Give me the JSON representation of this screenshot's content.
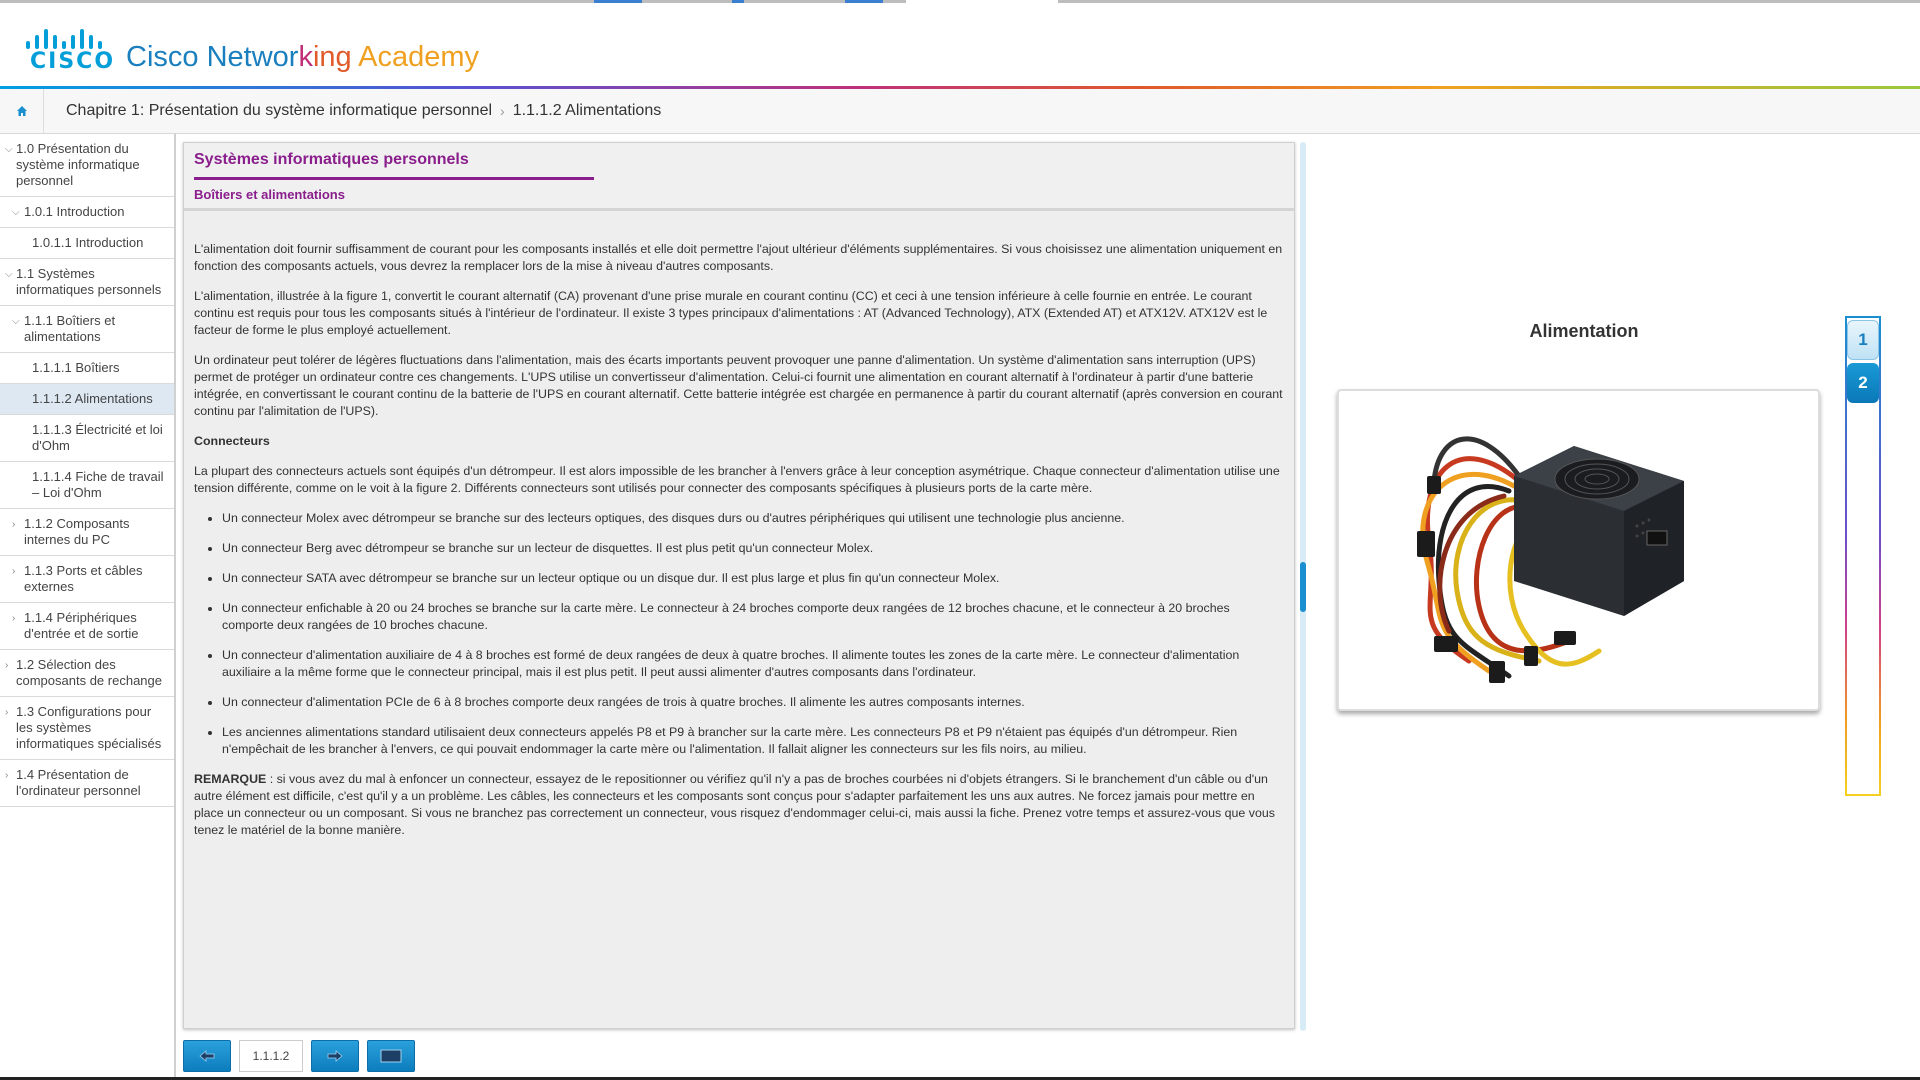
{
  "header": {
    "logo_word": "CISCO",
    "brand_parts": [
      {
        "text": "Cisco Networ",
        "color": "#1a7fbf"
      },
      {
        "text": "k",
        "color": "#c0307a"
      },
      {
        "text": "ing",
        "color": "#e05a2a"
      },
      {
        "text": " Academy",
        "color": "#f0a020"
      }
    ]
  },
  "breadcrumb": {
    "chapter": "Chapitre 1: Présentation du système informatique personnel",
    "page": "1.1.1.2 Alimentations"
  },
  "sidebar": {
    "items": [
      {
        "label": "1.0 Présentation du système informatique personnel",
        "level": 0,
        "chevron": "down"
      },
      {
        "label": "1.0.1 Introduction",
        "level": 1,
        "chevron": "down"
      },
      {
        "label": "1.0.1.1 Introduction",
        "level": 2,
        "chevron": ""
      },
      {
        "label": "1.1 Systèmes informatiques personnels",
        "level": 0,
        "chevron": "down"
      },
      {
        "label": "1.1.1 Boîtiers et alimentations",
        "level": 1,
        "chevron": "down"
      },
      {
        "label": "1.1.1.1 Boîtiers",
        "level": 2,
        "chevron": ""
      },
      {
        "label": "1.1.1.2 Alimentations",
        "level": 2,
        "chevron": "",
        "active": true
      },
      {
        "label": "1.1.1.3 Électricité et loi d'Ohm",
        "level": 2,
        "chevron": ""
      },
      {
        "label": "1.1.1.4 Fiche de travail – Loi d'Ohm",
        "level": 2,
        "chevron": ""
      },
      {
        "label": "1.1.2 Composants internes du PC",
        "level": 1,
        "chevron": "right"
      },
      {
        "label": "1.1.3 Ports et câbles externes",
        "level": 1,
        "chevron": "right"
      },
      {
        "label": "1.1.4 Périphériques d'entrée et de sortie",
        "level": 1,
        "chevron": "right"
      },
      {
        "label": "1.2 Sélection des composants de rechange",
        "level": 0,
        "chevron": "right"
      },
      {
        "label": "1.3 Configurations pour les systèmes informatiques spécialisés",
        "level": 0,
        "chevron": "right"
      },
      {
        "label": "1.4 Présentation de l'ordinateur personnel",
        "level": 0,
        "chevron": "right"
      }
    ]
  },
  "content": {
    "title": "Systèmes informatiques personnels",
    "subtitle": "Boîtiers et alimentations",
    "p1": "L'alimentation doit fournir suffisamment de courant pour les composants installés et elle doit permettre l'ajout ultérieur d'éléments supplémentaires. Si vous choisissez une alimentation uniquement en fonction des composants actuels, vous devrez la remplacer lors de la mise à niveau d'autres composants.",
    "p2": "L'alimentation, illustrée à la figure 1, convertit le courant alternatif (CA) provenant d'une prise murale en courant continu (CC) et ceci à une tension inférieure à celle fournie en entrée. Le courant continu est requis pour tous les composants situés à l'intérieur de l'ordinateur. Il existe 3 types principaux d'alimentations : AT (Advanced Technology), ATX (Extended AT) et ATX12V. ATX12V est le facteur de forme le plus employé actuellement.",
    "p3": "Un ordinateur peut tolérer de légères fluctuations dans l'alimentation, mais des écarts importants peuvent provoquer une panne d'alimentation. Un système d'alimentation sans interruption (UPS) permet de protéger un ordinateur contre ces changements. L'UPS utilise un convertisseur d'alimentation. Celui-ci fournit une alimentation en courant alternatif à l'ordinateur à partir d'une batterie intégrée, en convertissant le courant continu de la batterie de l'UPS en courant alternatif. Cette batterie intégrée est chargée en permanence à partir du courant alternatif (après conversion en courant continu par l'alimitation de l'UPS).",
    "connectors_heading": "Connecteurs",
    "p4": "La plupart des connecteurs actuels sont équipés d'un détrompeur. Il est alors impossible de les brancher à l'envers grâce à leur conception asymétrique. Chaque connecteur d'alimentation utilise une tension différente, comme on le voit à la figure 2. Différents connecteurs sont utilisés pour connecter des composants spécifiques à plusieurs ports de la carte mère.",
    "bullets": [
      "Un connecteur Molex avec détrompeur se branche sur des lecteurs optiques, des disques durs ou d'autres périphériques qui utilisent une technologie plus ancienne.",
      "Un connecteur Berg avec détrompeur se branche sur un lecteur de disquettes. Il est plus petit qu'un connecteur Molex.",
      "Un connecteur SATA avec détrompeur se branche sur un lecteur optique ou un disque dur. Il est plus large et plus fin qu'un connecteur Molex.",
      "Un connecteur enfichable à 20 ou 24 broches se branche sur la carte mère. Le connecteur à 24 broches comporte deux rangées de 12 broches chacune, et le connecteur à 20 broches comporte deux rangées de 10 broches chacune.",
      "Un connecteur d'alimentation auxiliaire de 4 à 8 broches est formé de deux rangées de deux à quatre broches. Il alimente toutes les zones de la carte mère. Le connecteur d'alimentation auxiliaire a la même forme que le connecteur principal, mais il est plus petit. Il peut aussi alimenter d'autres composants dans l'ordinateur.",
      "Un connecteur d'alimentation PCIe de 6 à 8 broches comporte deux rangées de trois à quatre broches. Il alimente les autres composants internes.",
      "Les anciennes alimentations standard utilisaient deux connecteurs appelés P8 et P9 à brancher sur la carte mère. Les connecteurs P8 et P9 n'étaient pas équipés d'un détrompeur. Rien n'empêchait de les brancher à l'envers, ce qui pouvait endommager la carte mère ou l'alimentation. Il fallait aligner les connecteurs sur les fils noirs, au milieu."
    ],
    "note_label": "REMARQUE",
    "note_text": " : si vous avez du mal à enfoncer un connecteur, essayez de le repositionner ou vérifiez qu'il n'y a pas de broches courbées ni d'objets étrangers. Si le branchement d'un câble ou d'un autre élément est difficile, c'est qu'il y a un problème. Les câbles, les connecteurs et les composants sont conçus pour s'adapter parfaitement les uns aux autres. Ne forcez jamais pour mettre en place un connecteur ou un composant. Si vous ne branchez pas correctement un connecteur, vous risquez d'endommager celui-ci, mais aussi la fiche. Prenez votre temps et assurez-vous que vous tenez le matériel de la bonne manière."
  },
  "bottom_nav": {
    "page_number": "1.1.1.2"
  },
  "figure": {
    "title": "Alimentation",
    "tabs": [
      "1",
      "2"
    ]
  },
  "colors": {
    "accent_purple": "#8a1e8c",
    "cisco_blue": "#049fd9",
    "button_blue": "#1a8fd0"
  }
}
